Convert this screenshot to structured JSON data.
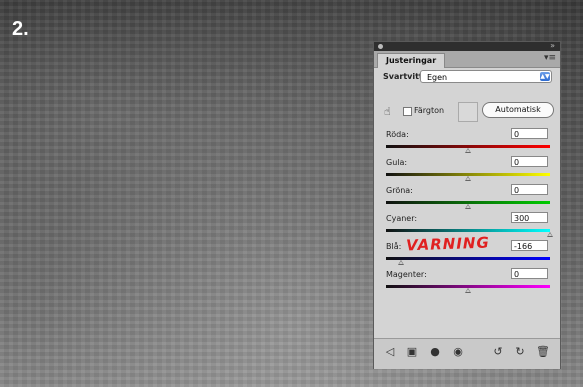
{
  "step": "2.",
  "panel": {
    "tab": "Justeringar",
    "preset_label": "Svartvitt",
    "preset_value": "Egen",
    "tint_label": "Färgton",
    "auto_button": "Automatisk",
    "sliders": [
      {
        "label": "Röda:",
        "value": "0",
        "level": 0.5,
        "colors": [
          "#111111",
          "#ff0000"
        ]
      },
      {
        "label": "Gula:",
        "value": "0",
        "level": 0.5,
        "colors": [
          "#111111",
          "#ffff00"
        ]
      },
      {
        "label": "Gröna:",
        "value": "0",
        "level": 0.5,
        "colors": [
          "#111111",
          "#00cc00"
        ]
      },
      {
        "label": "Cyaner:",
        "value": "300",
        "level": 1.0,
        "colors": [
          "#111111",
          "#00ffff"
        ]
      },
      {
        "label": "Blå:",
        "value": "-166",
        "level": 0.09,
        "colors": [
          "#111111",
          "#0000ff"
        ]
      },
      {
        "label": "Magenter:",
        "value": "0",
        "level": 0.5,
        "colors": [
          "#111111",
          "#ff00ff"
        ]
      }
    ]
  },
  "annotation": "VARNING",
  "icons": {
    "back": "back-arrow-icon",
    "new_layer": "layer-icon",
    "circle": "circle-icon",
    "eye": "eye-icon",
    "reset_prev": "reset-previous-icon",
    "reset": "reset-icon",
    "trash": "trash-icon"
  }
}
